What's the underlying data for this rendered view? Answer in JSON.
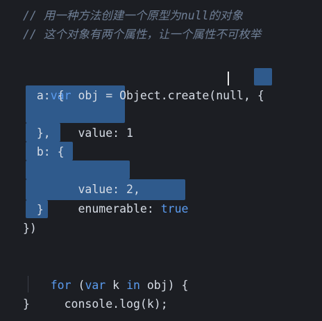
{
  "code": {
    "comment1": "// 用一种方法创建一个原型为null的对象",
    "comment2": "// 这个对象有两个属性，让一个属性不可枚举",
    "l4_var": "var",
    "l4_obj": " obj = ",
    "l4_Object": "Object",
    "l4_create": ".create(",
    "l4_null": "null",
    "l4_rest": ", {",
    "l5": "  a: {",
    "l6_key": "    value: ",
    "l6_val": "1",
    "l7": "  },",
    "l8": "  b: {",
    "l9_key": "    value: ",
    "l9_val": "2",
    "l9_comma": ",",
    "l10_key": "    enumerable: ",
    "l10_val": "true",
    "l11": "  }",
    "l12": "})",
    "l14_for": "for",
    "l14_open": " (",
    "l14_var": "var",
    "l14_k": " k ",
    "l14_in": "in",
    "l14_rest": " obj) {",
    "l15_console": "  console",
    "l15_log": ".log(k);",
    "l16": "}"
  },
  "colors": {
    "background": "#1c1e23",
    "selection": "#2f5a8c",
    "keyword": "#5b9cf0",
    "comment": "#6f7f96",
    "text": "#d7dde6"
  }
}
